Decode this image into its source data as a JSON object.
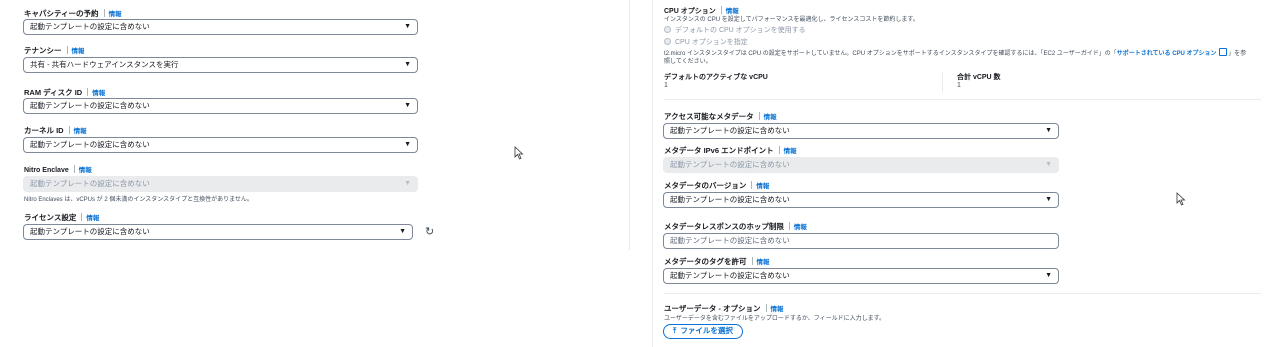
{
  "info_label": "情報",
  "left": {
    "capacity": {
      "label": "キャパシティーの予約",
      "value": "起動テンプレートの設定に含めない"
    },
    "tenancy": {
      "label": "テナンシー",
      "value": "共有 - 共有ハードウェアインスタンスを実行"
    },
    "ramdisk": {
      "label": "RAM ディスク ID",
      "value": "起動テンプレートの設定に含めない"
    },
    "kernel": {
      "label": "カーネル ID",
      "value": "起動テンプレートの設定に含めない"
    },
    "nitro": {
      "label": "Nitro Enclave",
      "value": "起動テンプレートの設定に含めない",
      "note": "Nitro Enclaves は、vCPUs が 2 個未満のインスタンスタイプと互換性がありません。"
    },
    "license": {
      "label": "ライセンス設定",
      "value": "起動テンプレートの設定に含めない"
    }
  },
  "right": {
    "cpu": {
      "title": "CPU オプション",
      "desc": "インスタンスの CPU を設定してパフォーマンスを最適化し、ライセンスコストを節約します。",
      "radio1": "デフォルトの CPU オプションを使用する",
      "radio2": "CPU オプションを指定",
      "note_prefix": "t2.micro インスタンスタイプは CPU の設定をサポートしていません。CPU オプションをサポートするインスタンスタイプを確認するには、「EC2 ユーザーガイド」の「",
      "note_link": "サポートされている CPU オプション",
      "note_suffix": "」を参",
      "note_line2": "照してください。",
      "active_vcpu_label": "デフォルトのアクティブな vCPU",
      "active_vcpu_value": "1",
      "total_vcpu_label": "合計 vCPU 数",
      "total_vcpu_value": "1"
    },
    "metadata_access": {
      "label": "アクセス可能なメタデータ",
      "value": "起動テンプレートの設定に含めない"
    },
    "metadata_ipv6": {
      "label": "メタデータ IPv6 エンドポイント",
      "value": "起動テンプレートの設定に含めない"
    },
    "metadata_version": {
      "label": "メタデータのバージョン",
      "value": "起動テンプレートの設定に含めない"
    },
    "metadata_hop": {
      "label": "メタデータレスポンスのホップ制限",
      "placeholder": "起動テンプレートの設定に含めない"
    },
    "metadata_tags": {
      "label": "メタデータのタグを許可",
      "value": "起動テンプレートの設定に含めない"
    },
    "user_data": {
      "title": "ユーザーデータ - オプション",
      "desc": "ユーザーデータを含むファイルをアップロードするか、フィールドに入力します。",
      "upload_label": "ファイルを選択"
    }
  }
}
